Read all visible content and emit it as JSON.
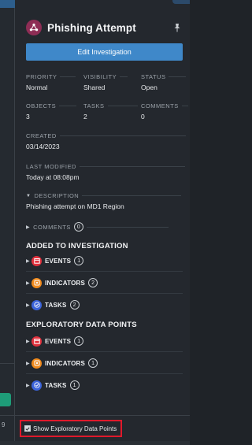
{
  "left_strip": {
    "cut_number": "9"
  },
  "header": {
    "title": "Phishing Attempt"
  },
  "edit_button": {
    "label": "Edit Investigation"
  },
  "fields": {
    "priority": {
      "label": "PRIORITY",
      "value": "Normal"
    },
    "visibility": {
      "label": "VISIBILITY",
      "value": "Shared"
    },
    "status": {
      "label": "STATUS",
      "value": "Open"
    },
    "objects": {
      "label": "OBJECTS",
      "value": "3"
    },
    "tasks": {
      "label": "TASKS",
      "value": "2"
    },
    "comments": {
      "label": "COMMENTS",
      "value": "0"
    },
    "created": {
      "label": "CREATED",
      "value": "03/14/2023"
    },
    "last_modified": {
      "label": "LAST MODIFIED",
      "value": "Today at 08:08pm"
    },
    "description": {
      "label": "DESCRIPTION",
      "value": "Phishing attempt on MD1 Region"
    }
  },
  "comments_row": {
    "label": "COMMENTS",
    "count": "0"
  },
  "added_section": {
    "title": "ADDED TO INVESTIGATION",
    "items": [
      {
        "label": "EVENTS",
        "count": "1",
        "icon": "calendar-icon",
        "color": "#e0313d"
      },
      {
        "label": "INDICATORS",
        "count": "2",
        "icon": "indicator-icon",
        "color": "#f08a1c"
      },
      {
        "label": "TASKS",
        "count": "2",
        "icon": "task-check-icon",
        "color": "#3b63d9"
      }
    ]
  },
  "exploratory_section": {
    "title": "EXPLORATORY DATA POINTS",
    "items": [
      {
        "label": "EVENTS",
        "count": "1",
        "icon": "calendar-icon",
        "color": "#e0313d"
      },
      {
        "label": "INDICATORS",
        "count": "1",
        "icon": "indicator-icon",
        "color": "#f08a1c"
      },
      {
        "label": "TASKS",
        "count": "1",
        "icon": "task-check-icon",
        "color": "#3b63d9"
      }
    ]
  },
  "footer": {
    "checkbox_label": "Show Exploratory Data Points",
    "checked": true
  },
  "colors": {
    "accent": "#3f88c9",
    "highlight_border": "#e0192b",
    "logo": "#8e2d55"
  }
}
